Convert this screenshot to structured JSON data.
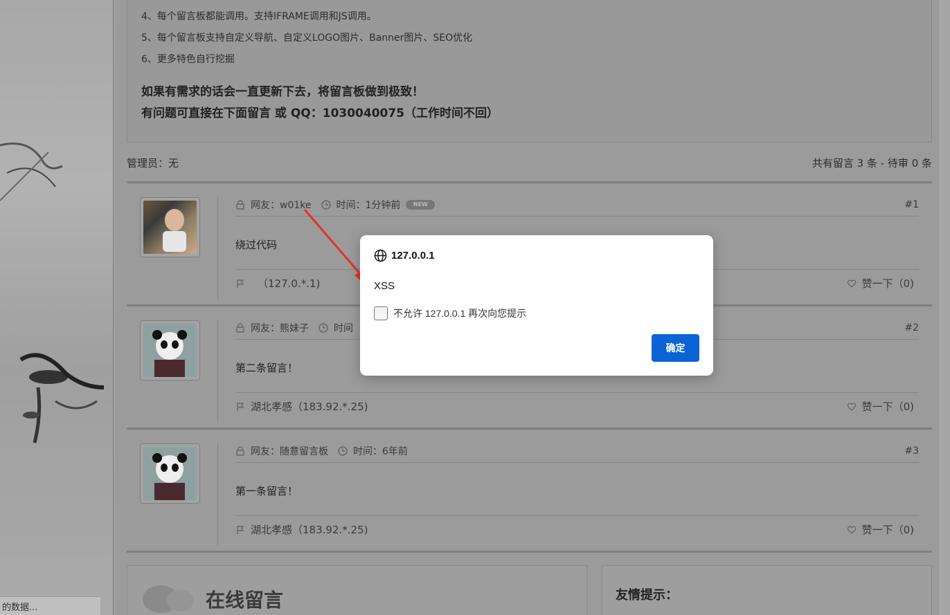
{
  "notice": {
    "lines": [
      "4、每个留言板都能调用。支持IFRAME调用和JS调用。",
      "5、每个留言板支持自定义导航、自定义LOGO图片、Banner图片、SEO优化",
      "6、更多特色自行挖掘"
    ],
    "bold_lines": [
      "如果有需求的话会一直更新下去，将留言板做到极致！",
      "有问题可直接在下面留言 或 QQ：1030040075（工作时间不回）"
    ]
  },
  "meta": {
    "admin": "管理员：无",
    "stats": "共有留言 3 条 - 待审 0 条"
  },
  "messages": [
    {
      "user": "网友：w01ke",
      "time": "时间：1分钟前",
      "badge": "NEW",
      "num": "#1",
      "content": "绕过代码",
      "location": "（127.0.*.1)",
      "like": "赞一下（0)",
      "avatar": "child-photo"
    },
    {
      "user": "网友：熊妹子",
      "time": "时间",
      "badge": "",
      "num": "#2",
      "content": "第二条留言！",
      "location": "湖北孝感（183.92.*.25)",
      "like": "赞一下（0)",
      "avatar": "panda-photo"
    },
    {
      "user": "网友：随意留言板",
      "time": "时间：6年前",
      "badge": "",
      "num": "#3",
      "content": "第一条留言！",
      "location": "湖北孝感（183.92.*.25)",
      "like": "赞一下（0)",
      "avatar": "panda-photo"
    }
  ],
  "bottom": {
    "left_title": "在线留言",
    "right_title": "友情提示："
  },
  "status_bar": "的数据...",
  "dialog": {
    "origin": "127.0.0.1",
    "message": "XSS",
    "checkbox_label": "不允许 127.0.0.1 再次向您提示",
    "ok_label": "确定"
  },
  "colors": {
    "ok_button": "#0b63d6",
    "arrow": "#e8302a",
    "overlay": "#999999"
  }
}
